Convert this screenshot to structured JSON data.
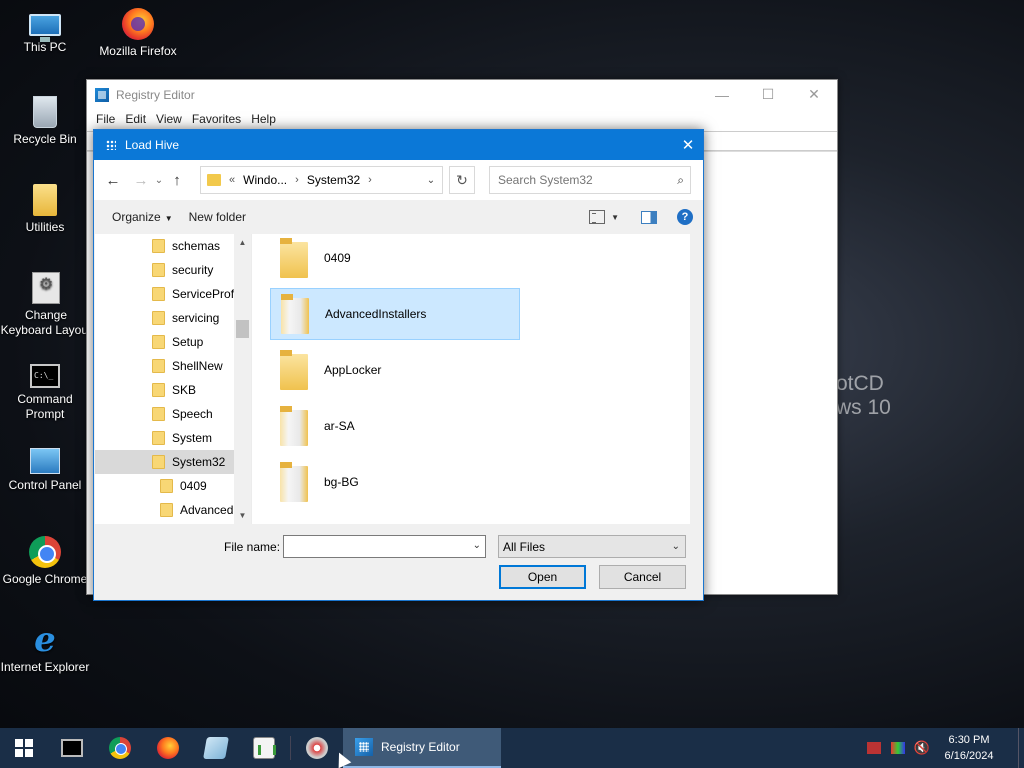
{
  "desktop": {
    "icons": [
      {
        "label": "This PC"
      },
      {
        "label": "Mozilla Firefox"
      },
      {
        "label": "Recycle Bin"
      },
      {
        "label": "Utilities"
      },
      {
        "label": "Change Keyboard Layout"
      },
      {
        "label": "Command Prompt"
      },
      {
        "label": "Control Panel"
      },
      {
        "label": "Google Chrome"
      },
      {
        "label": "Internet Explorer"
      }
    ],
    "wallpaper_text": [
      "otCD",
      "ws 10"
    ]
  },
  "regedit": {
    "title": "Registry Editor",
    "menu": [
      "File",
      "Edit",
      "View",
      "Favorites",
      "Help"
    ],
    "minimize": "—",
    "maximize": "☐",
    "close": "✕"
  },
  "dialog": {
    "title": "Load Hive",
    "close": "✕",
    "nav": {
      "back": "←",
      "forward": "→",
      "recent": "⌄",
      "up": "↑"
    },
    "address": {
      "prefix": "«",
      "crumbs": [
        "Windo...",
        "System32"
      ],
      "sep": "›",
      "dropdown": "⌄"
    },
    "refresh": "↻",
    "search": {
      "placeholder": "Search System32",
      "icon": "⌕"
    },
    "toolbar": {
      "organize": "Organize",
      "new_folder": "New folder",
      "help": "?"
    },
    "tree": [
      {
        "label": "schemas",
        "sub": false,
        "selected": false
      },
      {
        "label": "security",
        "sub": false,
        "selected": false
      },
      {
        "label": "ServiceProfi",
        "sub": false,
        "selected": false
      },
      {
        "label": "servicing",
        "sub": false,
        "selected": false
      },
      {
        "label": "Setup",
        "sub": false,
        "selected": false
      },
      {
        "label": "ShellNew",
        "sub": false,
        "selected": false
      },
      {
        "label": "SKB",
        "sub": false,
        "selected": false
      },
      {
        "label": "Speech",
        "sub": false,
        "selected": false
      },
      {
        "label": "System",
        "sub": false,
        "selected": false
      },
      {
        "label": "System32",
        "sub": false,
        "selected": true
      },
      {
        "label": "0409",
        "sub": true,
        "selected": false
      },
      {
        "label": "Advanced",
        "sub": true,
        "selected": false
      }
    ],
    "files": [
      {
        "name": "0409",
        "selected": false,
        "docs": false
      },
      {
        "name": "AdvancedInstallers",
        "selected": true,
        "docs": true
      },
      {
        "name": "AppLocker",
        "selected": false,
        "docs": false
      },
      {
        "name": "ar-SA",
        "selected": false,
        "docs": true
      },
      {
        "name": "bg-BG",
        "selected": false,
        "docs": true
      }
    ],
    "file_name_label": "File name:",
    "file_name_value": "",
    "filter_value": "All Files",
    "open_label": "Open",
    "cancel_label": "Cancel"
  },
  "taskbar": {
    "active_app": "Registry Editor",
    "time": "6:30 PM",
    "date": "6/16/2024",
    "volume_icon": "🔇"
  }
}
